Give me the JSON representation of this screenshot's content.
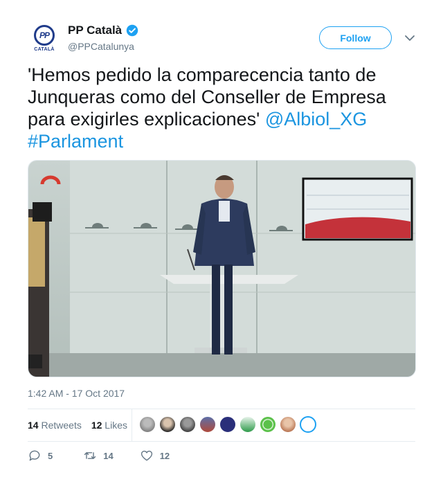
{
  "account": {
    "display_name": "PP Català",
    "handle": "@PPCatalunya",
    "avatar_text": "PP",
    "avatar_caption": "CATALÀ",
    "verified": true
  },
  "follow_label": "Follow",
  "tweet": {
    "text": "'Hemos pedido la comparecencia tanto de Junqueras como del Conseller de Empresa para exigirles explicaciones' ",
    "mention": "@Albiol_XG",
    "hashtag": "#Parlament"
  },
  "timestamp": "1:42 AM - 17 Oct 2017",
  "stats": {
    "retweets_count": "14",
    "retweets_label": "Retweets",
    "likes_count": "12",
    "likes_label": "Likes"
  },
  "actions": {
    "reply_count": "5",
    "retweet_count": "14",
    "like_count": "12"
  },
  "colors": {
    "link": "#1b95e0",
    "follow": "#1da1f2",
    "muted": "#657786",
    "brand": "#1f3b8a"
  },
  "icons": [
    "verified-badge-icon",
    "chevron-down-icon",
    "reply-icon",
    "retweet-icon",
    "heart-icon"
  ]
}
